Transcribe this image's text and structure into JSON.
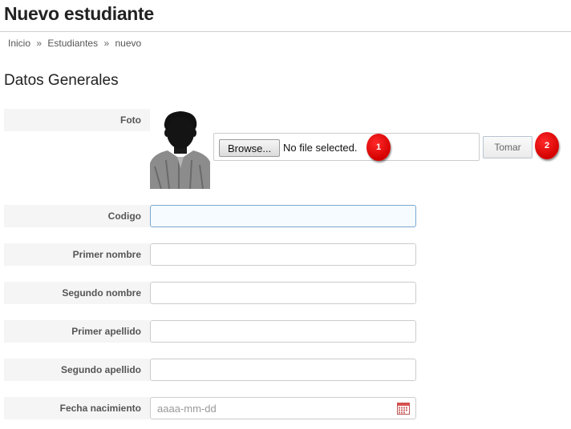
{
  "page": {
    "title": "Nuevo estudiante"
  },
  "breadcrumb": {
    "items": [
      "Inicio",
      "Estudiantes",
      "nuevo"
    ],
    "separator": "»"
  },
  "section": {
    "title": "Datos Generales"
  },
  "photo": {
    "label": "Foto",
    "browse_label": "Browse...",
    "file_status": "No file selected.",
    "take_label": "Tomar"
  },
  "annotations": {
    "badge_1": "1",
    "badge_2": "2",
    "color": "#e00000"
  },
  "fields": {
    "codigo": {
      "label": "Codigo",
      "value": ""
    },
    "primer_nombre": {
      "label": "Primer nombre",
      "value": ""
    },
    "segundo_nombre": {
      "label": "Segundo nombre",
      "value": ""
    },
    "primer_apellido": {
      "label": "Primer apellido",
      "value": ""
    },
    "segundo_apellido": {
      "label": "Segundo apellido",
      "value": ""
    },
    "fecha_nacimiento": {
      "label": "Fecha nacimiento",
      "placeholder": "aaaa-mm-dd",
      "value": ""
    }
  },
  "icons": {
    "calendar": "calendar-icon"
  },
  "colors": {
    "focus_border": "#7aa7cf",
    "label_bg": "#f5f5f5"
  }
}
